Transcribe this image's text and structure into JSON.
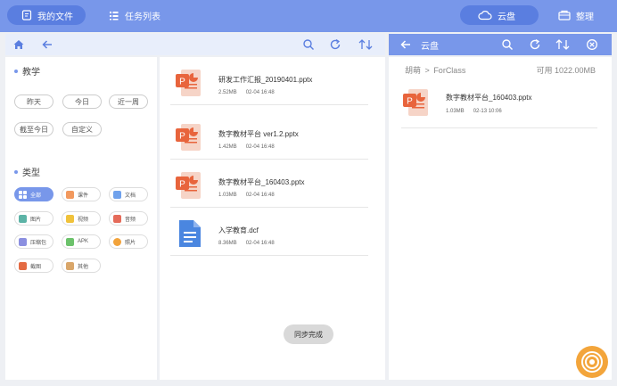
{
  "topbar": {
    "my_files": "我的文件",
    "task_list": "任务列表",
    "cloud": "云盘",
    "organize": "整理"
  },
  "cloud_header": {
    "title": "云盘"
  },
  "filters": {
    "section_teaching": "教学",
    "time_filters": [
      "昨天",
      "今日",
      "近一周",
      "截至今日",
      "自定义"
    ],
    "section_type": "类型",
    "types": [
      {
        "label": "全部",
        "icon": "grid-icon",
        "color": "#ffffff"
      },
      {
        "label": "课件",
        "icon": "courseware-icon",
        "color": "#f2995e"
      },
      {
        "label": "文档",
        "icon": "document-icon",
        "color": "#6fa1ec"
      },
      {
        "label": "图片",
        "icon": "image-icon",
        "color": "#5cb3a6"
      },
      {
        "label": "视频",
        "icon": "video-icon",
        "color": "#f0c23b"
      },
      {
        "label": "音频",
        "icon": "audio-icon",
        "color": "#e56b5a"
      },
      {
        "label": "压缩包",
        "icon": "archive-icon",
        "color": "#8b8fe0"
      },
      {
        "label": "APK",
        "icon": "apk-icon",
        "color": "#6cc26b"
      },
      {
        "label": "照片",
        "icon": "photo-icon",
        "color": "#f2a33b"
      },
      {
        "label": "截图",
        "icon": "screenshot-icon",
        "color": "#e46b43"
      },
      {
        "label": "其他",
        "icon": "other-icon",
        "color": "#d9a66a"
      }
    ]
  },
  "files": [
    {
      "name": "研发工作汇报_20190401.pptx",
      "size": "2.52MB",
      "date": "02-04 16:48",
      "type": "ppt"
    },
    {
      "name": "数字教材平台 ver1.2.pptx",
      "size": "1.42MB",
      "date": "02-04 16:48",
      "type": "ppt"
    },
    {
      "name": "数字教材平台_160403.pptx",
      "size": "1.03MB",
      "date": "02-04 16:48",
      "type": "ppt"
    },
    {
      "name": "入学教育.dcf",
      "size": "8.36MB",
      "date": "02-04 16:48",
      "type": "doc"
    }
  ],
  "cloud": {
    "breadcrumb_root": "胡萌",
    "breadcrumb_sep": ">",
    "breadcrumb_folder": "ForClass",
    "available": "可用 1022.00MB",
    "files": [
      {
        "name": "数字教材平台_160403.pptx",
        "size": "1.03MB",
        "date": "02-13 10:06",
        "type": "ppt"
      }
    ]
  },
  "toast": "同步完成",
  "colors": {
    "accent": "#7897ea",
    "ppt": "#e8643c",
    "doc": "#4a86e0",
    "fab": "#f3a53b"
  }
}
